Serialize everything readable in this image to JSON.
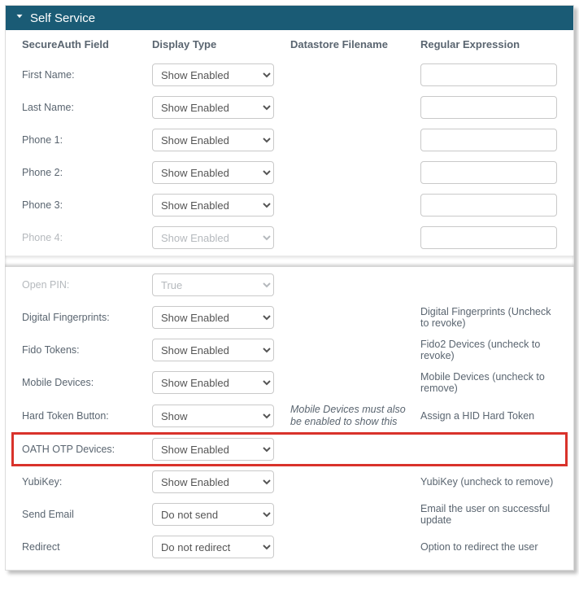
{
  "panel": {
    "title": "Self Service"
  },
  "headers": {
    "field": "SecureAuth Field",
    "displayType": "Display Type",
    "datastore": "Datastore Filename",
    "regex": "Regular Expression"
  },
  "options": {
    "showEnabled": "Show Enabled",
    "show": "Show",
    "true": "True",
    "doNotSend": "Do not send",
    "doNotRedirect": "Do not redirect"
  },
  "rows": {
    "firstName": {
      "label": "First Name:",
      "display": "Show Enabled",
      "hasRegex": true
    },
    "lastName": {
      "label": "Last Name:",
      "display": "Show Enabled",
      "hasRegex": true
    },
    "phone1": {
      "label": "Phone 1:",
      "display": "Show Enabled",
      "hasRegex": true
    },
    "phone2": {
      "label": "Phone 2:",
      "display": "Show Enabled",
      "hasRegex": true
    },
    "phone3": {
      "label": "Phone 3:",
      "display": "Show Enabled",
      "hasRegex": true
    },
    "phone4": {
      "label": "Phone 4:",
      "display": "Show Enabled",
      "hasRegex": true,
      "dim": true
    },
    "openPin": {
      "label": "Open PIN:",
      "display": "True",
      "dim": true
    },
    "digitalFp": {
      "label": "Digital Fingerprints:",
      "display": "Show Enabled",
      "regexText": "Digital Fingerprints (Uncheck to revoke)"
    },
    "fido": {
      "label": "Fido Tokens:",
      "display": "Show Enabled",
      "regexText": "Fido2 Devices (uncheck to revoke)"
    },
    "mobile": {
      "label": "Mobile Devices:",
      "display": "Show Enabled",
      "regexText": "Mobile Devices (uncheck to remove)"
    },
    "hardToken": {
      "label": "Hard Token Button:",
      "display": "Show",
      "note": "Mobile Devices must also be enabled to show this",
      "regexText": "Assign a HID Hard Token"
    },
    "oathOtp": {
      "label": "OATH OTP Devices:",
      "display": "Show Enabled",
      "highlight": true
    },
    "yubikey": {
      "label": "YubiKey:",
      "display": "Show Enabled",
      "regexText": "YubiKey (uncheck to remove)"
    },
    "sendEmail": {
      "label": "Send Email",
      "display": "Do not send",
      "regexText": "Email the user on successful update"
    },
    "redirect": {
      "label": "Redirect",
      "display": "Do not redirect",
      "regexText": "Option to redirect the user"
    }
  }
}
